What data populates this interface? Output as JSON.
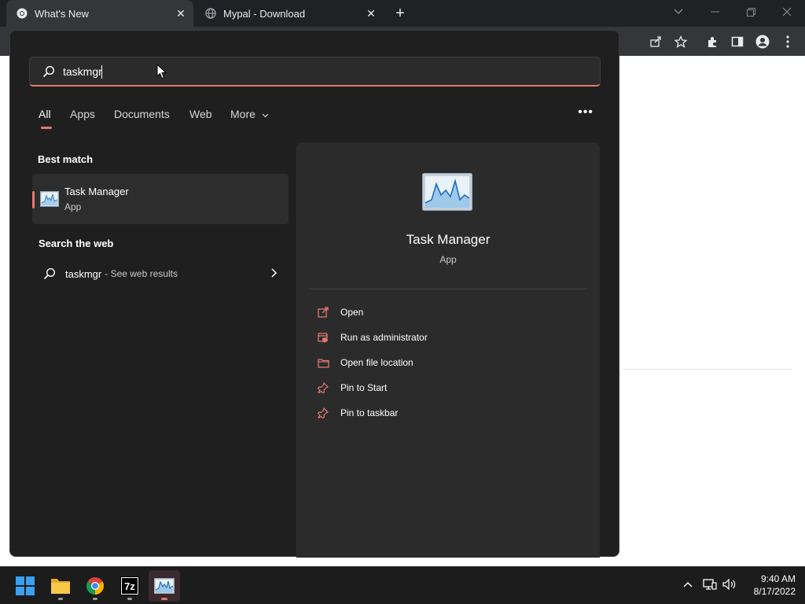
{
  "browser": {
    "tabs": [
      {
        "title": "What's New",
        "icon": "chrome-icon",
        "active": true
      },
      {
        "title": "Mypal - Download",
        "icon": "globe-icon",
        "active": false
      }
    ],
    "new_tab_icon": "plus-icon"
  },
  "search": {
    "query": "taskmgr",
    "filters": [
      "All",
      "Apps",
      "Documents",
      "Web",
      "More"
    ],
    "active_filter": "All",
    "accent_color": "#e4786e"
  },
  "best_match": {
    "title": "Best match",
    "name": "Task Manager",
    "type": "App"
  },
  "web": {
    "title": "Search the web",
    "query": "taskmgr",
    "suffix": "- See web results"
  },
  "preview": {
    "name": "Task Manager",
    "type": "App",
    "actions": [
      {
        "label": "Open",
        "icon": "open-icon"
      },
      {
        "label": "Run as administrator",
        "icon": "shield-icon"
      },
      {
        "label": "Open file location",
        "icon": "folder-icon"
      },
      {
        "label": "Pin to Start",
        "icon": "pin-icon"
      },
      {
        "label": "Pin to taskbar",
        "icon": "pin-icon"
      }
    ]
  },
  "taskbar": {
    "apps": [
      "start",
      "file-explorer",
      "chrome",
      "7-zip",
      "task-manager"
    ],
    "active_app": "task-manager"
  },
  "clock": {
    "time": "9:40 AM",
    "date": "8/17/2022"
  }
}
